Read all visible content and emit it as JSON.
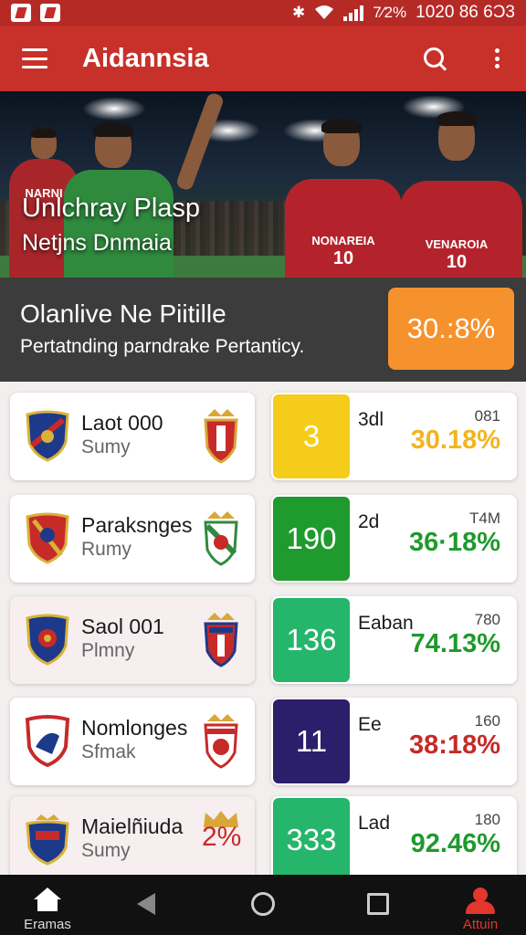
{
  "status_bar": {
    "battery": "7⁄2%",
    "time": "1020 86 6Ɔ3",
    "icons": [
      "app-notification-icon",
      "app-notification-icon",
      "bluetooth-icon",
      "wifi-icon",
      "signal-icon"
    ]
  },
  "app_bar": {
    "title": "Aidannsia",
    "icons": [
      "menu-icon",
      "search-icon",
      "more-vert-icon"
    ]
  },
  "hero": {
    "line1": "Unlchray Plasp",
    "line2": "Netjns Dnmaia",
    "jersey_left": "NONAREIA",
    "jersey_right": "VENAROIA",
    "jersey_number": "10",
    "jersey_small": "NARNI"
  },
  "promo": {
    "title": "Olanlive Ne Piitille",
    "subtitle": "Pertatnding parndrake Pertanticy.",
    "badge": "30.:8%"
  },
  "rows": [
    {
      "team_name": "Laot 000",
      "team_sub": "Sumy",
      "team_pct": "",
      "stat_value": "3",
      "stat_label": "3dl",
      "stat_small": "081",
      "stat_pct": "30.18%"
    },
    {
      "team_name": "Paraksnges",
      "team_sub": "Rumy",
      "team_pct": "",
      "stat_value": "190",
      "stat_label": "2d",
      "stat_small": "T4M",
      "stat_pct": "36·18%"
    },
    {
      "team_name": "Saol 001",
      "team_sub": "Plmny",
      "team_pct": "",
      "stat_value": "136",
      "stat_label": "Eaban",
      "stat_small": "780",
      "stat_pct": "74.13%"
    },
    {
      "team_name": "Nomlonges",
      "team_sub": "Sfmak",
      "team_pct": "",
      "stat_value": "11",
      "stat_label": "Ee",
      "stat_small": "160",
      "stat_pct": "38:18%"
    },
    {
      "team_name": "Maielñiuda",
      "team_sub": "Sumy",
      "team_pct": "2%",
      "stat_value": "333",
      "stat_label": "Lad",
      "stat_small": "180",
      "stat_pct": "92.46%"
    }
  ],
  "colors": {
    "brand_red": "#c8302a",
    "promo_orange": "#f5922d",
    "stat_boxes": [
      "#f6cc1a",
      "#1f9a2c",
      "#25b56b",
      "#2b1f6b",
      "#25b56b"
    ],
    "stat_pcts": [
      "#f2b51c",
      "#1f9a2c",
      "#1f9a2c",
      "#c62b28",
      "#1f9a2c"
    ]
  },
  "bottom_nav": {
    "home_label": "Eramas",
    "profile_label": "Attuin",
    "icons": [
      "home-icon",
      "back-icon",
      "home-circle-icon",
      "recents-icon",
      "profile-icon"
    ]
  }
}
